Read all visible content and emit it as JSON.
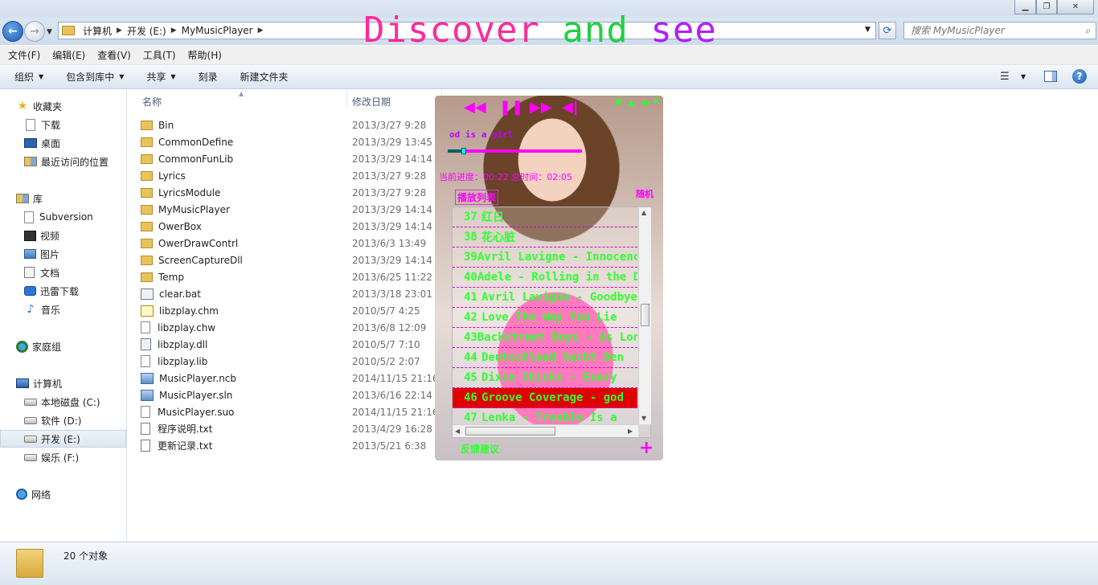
{
  "overlay_title": {
    "w1": "Discover",
    "w2": "and",
    "w3": "see"
  },
  "address": {
    "crumbs": [
      "计算机",
      "开发 (E:)",
      "MyMusicPlayer"
    ],
    "search_placeholder": "搜索 MyMusicPlayer"
  },
  "menu": [
    "文件(F)",
    "编辑(E)",
    "查看(V)",
    "工具(T)",
    "帮助(H)"
  ],
  "toolbar": [
    "组织",
    "包含到库中",
    "共享",
    "刻录",
    "新建文件夹"
  ],
  "nav": {
    "favorites": "收藏夹",
    "downloads": "下载",
    "desktop": "桌面",
    "recent": "最近访问的位置",
    "libraries": "库",
    "subversion": "Subversion",
    "videos": "视频",
    "pictures": "图片",
    "documents": "文档",
    "xunlei": "迅雷下载",
    "music": "音乐",
    "homegroup": "家庭组",
    "computer": "计算机",
    "drive_c": "本地磁盘 (C:)",
    "drive_d": "软件 (D:)",
    "drive_e": "开发 (E:)",
    "drive_f": "娱乐 (F:)",
    "network": "网络"
  },
  "columns": {
    "name": "名称",
    "date": "修改日期"
  },
  "files": [
    {
      "name": "Bin",
      "date": "2013/3/27 9:28",
      "type": "folder"
    },
    {
      "name": "CommonDefine",
      "date": "2013/3/29 13:45",
      "type": "folder"
    },
    {
      "name": "CommonFunLib",
      "date": "2013/3/29 14:14",
      "type": "folder"
    },
    {
      "name": "Lyrics",
      "date": "2013/3/27 9:28",
      "type": "folder"
    },
    {
      "name": "LyricsModule",
      "date": "2013/3/27 9:28",
      "type": "folder"
    },
    {
      "name": "MyMusicPlayer",
      "date": "2013/3/29 14:14",
      "type": "folder"
    },
    {
      "name": "OwerBox",
      "date": "2013/3/29 14:14",
      "type": "folder"
    },
    {
      "name": "OwerDrawContrl",
      "date": "2013/6/3 13:49",
      "type": "folder"
    },
    {
      "name": "ScreenCaptureDll",
      "date": "2013/3/29 14:14",
      "type": "folder"
    },
    {
      "name": "Temp",
      "date": "2013/6/25 11:22",
      "type": "folder"
    },
    {
      "name": "clear.bat",
      "date": "2013/3/18 23:01",
      "type": "bat"
    },
    {
      "name": "libzplay.chm",
      "date": "2010/5/7 4:25",
      "type": "chm"
    },
    {
      "name": "libzplay.chw",
      "date": "2013/6/8 12:09",
      "type": "file"
    },
    {
      "name": "libzplay.dll",
      "date": "2010/5/7 7:10",
      "type": "dll"
    },
    {
      "name": "libzplay.lib",
      "date": "2010/5/2 2:07",
      "type": "file"
    },
    {
      "name": "MusicPlayer.ncb",
      "date": "2014/11/15 21:16",
      "type": "vs"
    },
    {
      "name": "MusicPlayer.sln",
      "date": "2013/6/16 22:14",
      "type": "vs"
    },
    {
      "name": "MusicPlayer.suo",
      "date": "2014/11/15 21:16",
      "type": "file"
    },
    {
      "name": "程序说明.txt",
      "date": "2013/4/29 16:28",
      "type": "txt"
    },
    {
      "name": "更新记录.txt",
      "date": "2013/5/21 6:38",
      "type": "txt"
    }
  ],
  "player": {
    "now_playing": "od is a girl",
    "time_text": "当前进度：00:22  总时间：02:05",
    "progress": 0.12,
    "random_label": "随机",
    "playlist_tab": "播放列表",
    "songs": [
      {
        "num": "37",
        "title": "红日"
      },
      {
        "num": "38",
        "title": "花心脏"
      },
      {
        "num": "39",
        "title": "Avril Lavigne - Innocence"
      },
      {
        "num": "40",
        "title": "Adele - Rolling in the Deep"
      },
      {
        "num": "41",
        "title": "Avril Lavigne - Goodbye"
      },
      {
        "num": "42",
        "title": "Love The Way You Lie"
      },
      {
        "num": "43",
        "title": "Backstreet Boys - As Long"
      },
      {
        "num": "44",
        "title": "Deutschland Sucht Den"
      },
      {
        "num": "45",
        "title": "Dixie Chicks - Every"
      },
      {
        "num": "46",
        "title": "Groove Coverage - god"
      },
      {
        "num": "47",
        "title": "Lenka - Trouble Is a"
      }
    ],
    "active_index": 9,
    "feedback": "反馈建议"
  },
  "status": {
    "count": "20 个对象"
  }
}
